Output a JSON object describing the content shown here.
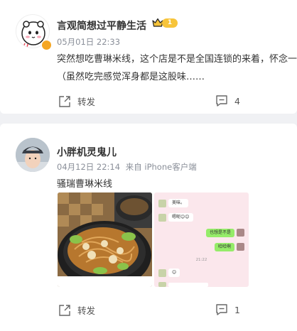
{
  "post1": {
    "user_name": "言观简想过平静生活",
    "level": "1",
    "timestamp": "05月01日 22:33",
    "text_line1": "突然想吃曹琳米线，这个店是不是全国连锁的来着，怀念一下",
    "text_line2": "（虽然吃完感觉浑身都是这股味……",
    "repost_label": "转发",
    "comment_count": "4"
  },
  "post2": {
    "user_name": "小胖机灵鬼儿",
    "timestamp": "04月12日 22:14",
    "source": "来自 iPhone客户端",
    "text": "骚瑞曹琳米线",
    "chat": {
      "msg1": "美味。",
      "msg2": "嗯呢😊😊",
      "msg3": "也想是不是",
      "msg4": "哈哈啊",
      "time": "21:22",
      "msg5": "😊"
    },
    "repost_label": "转发",
    "comment_count": "1"
  },
  "icons": {
    "repost": "repost-icon",
    "comment": "comment-icon",
    "crown": "crown-icon",
    "verified": "verified-icon"
  },
  "colors": {
    "accent_orange": "#f5a623",
    "crown_gold": "#f7c43a",
    "meta_gray": "#8a8f99",
    "chat_green": "#95ec69"
  }
}
